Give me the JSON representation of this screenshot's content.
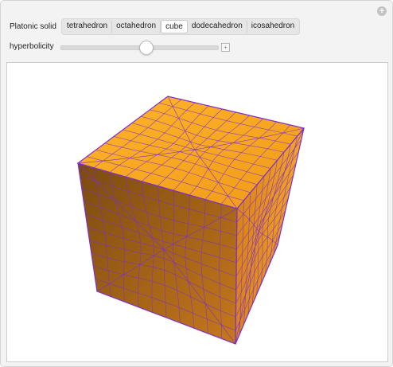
{
  "controls": {
    "solid_label": "Platonic solid",
    "solids": [
      "tetrahedron",
      "octahedron",
      "cube",
      "dodecahedron",
      "icosahedron"
    ],
    "selected_solid": "cube",
    "hyperbolicity_label": "hyperbolicity",
    "hyperbolicity_value": 0.54
  },
  "colors": {
    "panel_bg": "#f3f3f3",
    "face_light": "#f5a620",
    "face_dark": "#7a4a10",
    "mesh": "#7d2fd0"
  },
  "icons": {
    "expand": "plus-circle-icon",
    "slider_expand": "plus-square-icon"
  }
}
